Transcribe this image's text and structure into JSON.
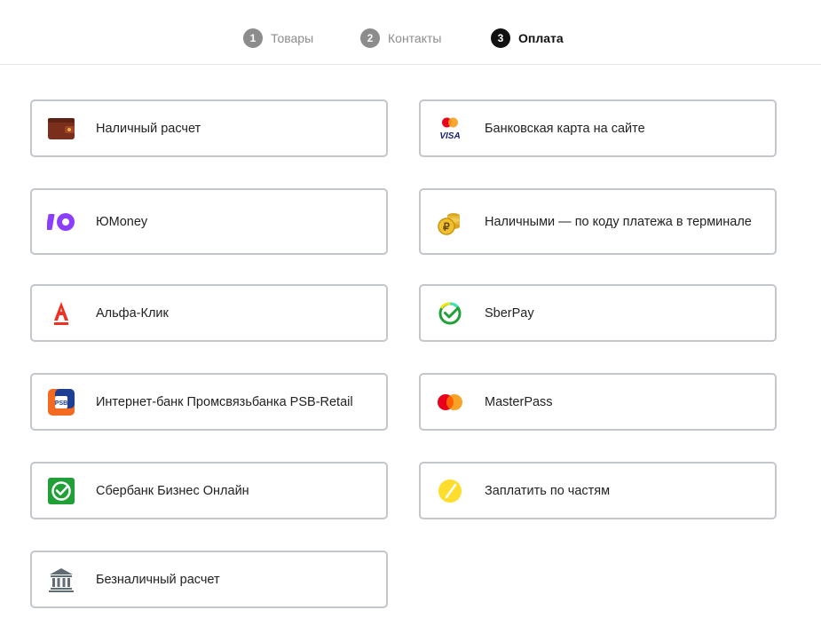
{
  "steps": [
    {
      "number": "1",
      "label": "Товары",
      "active": false
    },
    {
      "number": "2",
      "label": "Контакты",
      "active": false
    },
    {
      "number": "3",
      "label": "Оплата",
      "active": true
    }
  ],
  "payment_methods": [
    {
      "label": "Наличный расчет",
      "icon": "wallet-icon"
    },
    {
      "label": "Банковская карта на сайте",
      "icon": "mastercard-visa-icon"
    },
    {
      "label": "ЮMoney",
      "icon": "yoomoney-icon"
    },
    {
      "label": "Наличными — по коду платежа в терминале",
      "icon": "coins-ruble-icon"
    },
    {
      "label": "Альфа-Клик",
      "icon": "alfa-bank-icon"
    },
    {
      "label": "SberPay",
      "icon": "sberpay-icon"
    },
    {
      "label": "Интернет-банк Промсвязьбанка PSB-Retail",
      "icon": "psb-icon"
    },
    {
      "label": "MasterPass",
      "icon": "masterpass-icon"
    },
    {
      "label": "Сбербанк Бизнес Онлайн",
      "icon": "sberbank-business-icon"
    },
    {
      "label": "Заплатить по частям",
      "icon": "installments-icon"
    },
    {
      "label": "Безналичный расчет",
      "icon": "bank-building-icon"
    }
  ],
  "colors": {
    "card_border": "#c3c7cb",
    "step_inactive": "#8c8c8c",
    "step_active": "#111111"
  }
}
